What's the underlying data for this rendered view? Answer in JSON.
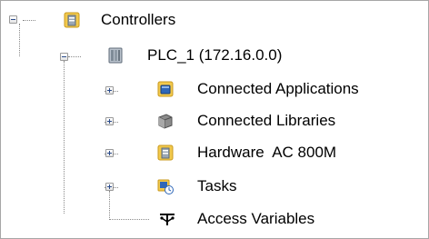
{
  "tree": {
    "root": {
      "label": "Controllers",
      "icon": "controller-folder-icon",
      "expanded": true,
      "children": [
        {
          "label": "PLC_1 (172.16.0.0)",
          "icon": "plc-icon",
          "expanded": true,
          "children": [
            {
              "label": "Connected Applications",
              "icon": "application-icon",
              "expanded": false
            },
            {
              "label": "Connected Libraries",
              "icon": "library-icon",
              "expanded": false
            },
            {
              "label": "Hardware  AC 800M",
              "icon": "hardware-icon",
              "expanded": false
            },
            {
              "label": "Tasks",
              "icon": "tasks-icon",
              "expanded": false
            },
            {
              "label": "Access Variables",
              "icon": "access-variables-icon"
            }
          ]
        }
      ]
    }
  },
  "colors": {
    "folder_yellow": "#f2c94c",
    "app_blue": "#2e67b8",
    "library_gray": "#8c8c8c",
    "tree_line": "#8a8a8a"
  }
}
